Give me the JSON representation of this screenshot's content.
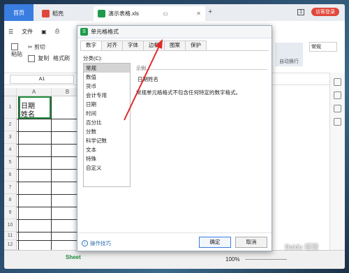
{
  "tabs": {
    "home": "首页",
    "daoke": "稻壳",
    "doc": "演示表格.xls"
  },
  "window": {
    "page_count": "1",
    "login": "访客登录"
  },
  "menu": {
    "file": "文件"
  },
  "ribbon": {
    "cut": "剪切",
    "copy": "复制",
    "format_painter": "格式刷",
    "paste": "粘贴",
    "auto_wrap": "自动换行",
    "normal": "常规"
  },
  "formula": {
    "namebox": "A1"
  },
  "grid": {
    "columns": [
      "A",
      "B"
    ],
    "rows": [
      "1",
      "2",
      "3",
      "4",
      "5",
      "6",
      "7",
      "8",
      "9",
      "10",
      "11",
      "12"
    ],
    "a1_line1": "日期",
    "a1_line2": "姓名"
  },
  "status": {
    "sheet": "Sheet",
    "zoom": "100%"
  },
  "dialog": {
    "title": "单元格格式",
    "tabs": [
      "数字",
      "对齐",
      "字体",
      "边框",
      "图案",
      "保护"
    ],
    "category_label": "分类(C):",
    "categories": [
      "常规",
      "数值",
      "货币",
      "会计专用",
      "日期",
      "时间",
      "百分比",
      "分数",
      "科学记数",
      "文本",
      "特殊",
      "自定义"
    ],
    "sample_label": "示例",
    "sample_value": "日期姓名",
    "description": "常规单元格格式不包含任何特定的数字格式。",
    "tips": "操作技巧",
    "ok": "确定",
    "cancel": "取消"
  },
  "watermark": "Baidu 经验"
}
